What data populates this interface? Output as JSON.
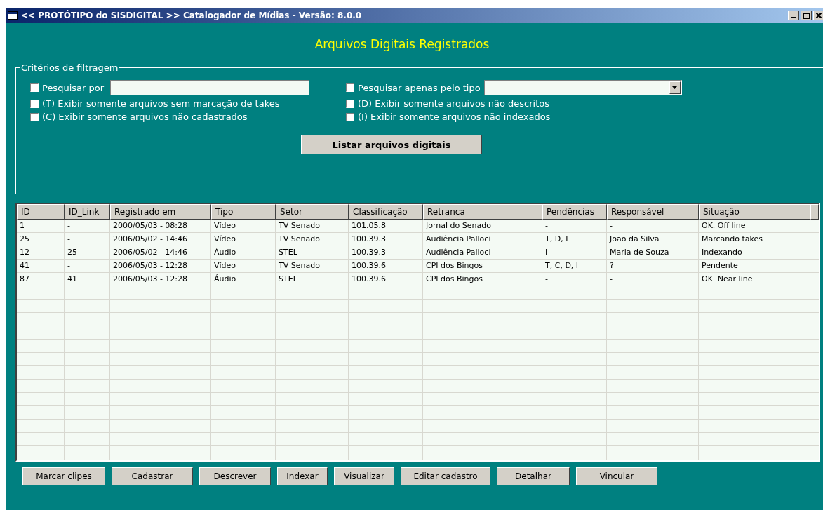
{
  "window": {
    "title": "<< PROTÓTIPO do SISDIGITAL >> Catalogador de Mídias - Versão: 8.0.0",
    "heading": "Arquivos Digitais Registrados"
  },
  "filter": {
    "legend": "Critérios de filtragem",
    "search": {
      "label": "Pesquisar por",
      "checked": false
    },
    "type": {
      "label": "Pesquisar apenas pelo tipo",
      "checked": false
    },
    "options": [
      {
        "label": "(T) Exibir somente arquivos sem marcação de takes",
        "checked": false
      },
      {
        "label": "(D) Exibir somente arquivos não descritos",
        "checked": false
      },
      {
        "label": "(C) Exibir somente arquivos não cadastrados",
        "checked": false
      },
      {
        "label": "(I) Exibir somente arquivos não indexados",
        "checked": false
      }
    ],
    "list_button": "Listar arquivos digitais"
  },
  "table": {
    "columns": [
      "ID",
      "ID_Link",
      "Registrado em",
      "Tipo",
      "Setor",
      "Classificação",
      "Retranca",
      "Pendências",
      "Responsável",
      "Situação"
    ],
    "rows": [
      [
        "1",
        "-",
        "2000/05/03 - 08:28",
        "Vídeo",
        "TV Senado",
        "101.05.8",
        "Jornal do Senado",
        "-",
        "-",
        "OK. Off line"
      ],
      [
        "25",
        "-",
        "2006/05/02 - 14:46",
        "Vídeo",
        "TV Senado",
        "100.39.3",
        "Audiência Palloci",
        "T, D, I",
        "João da Silva",
        "Marcando takes"
      ],
      [
        "12",
        "25",
        "2006/05/02 - 14:46",
        "Áudio",
        "STEL",
        "100.39.3",
        "Audiência Palloci",
        "I",
        "Maria de Souza",
        "Indexando"
      ],
      [
        "41",
        "-",
        "2006/05/03 - 12:28",
        "Vídeo",
        "TV Senado",
        "100.39.6",
        "CPI dos Bingos",
        "T, C, D, I",
        "?",
        "Pendente"
      ],
      [
        "87",
        "41",
        "2006/05/03 - 12:28",
        "Áudio",
        "STEL",
        "100.39.6",
        "CPI dos Bingos",
        "-",
        "-",
        "OK. Near line"
      ]
    ]
  },
  "buttons": [
    "Marcar clipes",
    "Cadastrar",
    "Descrever",
    "Indexar",
    "Visualizar",
    "Editar cadastro",
    "Detalhar",
    "Vincular"
  ]
}
